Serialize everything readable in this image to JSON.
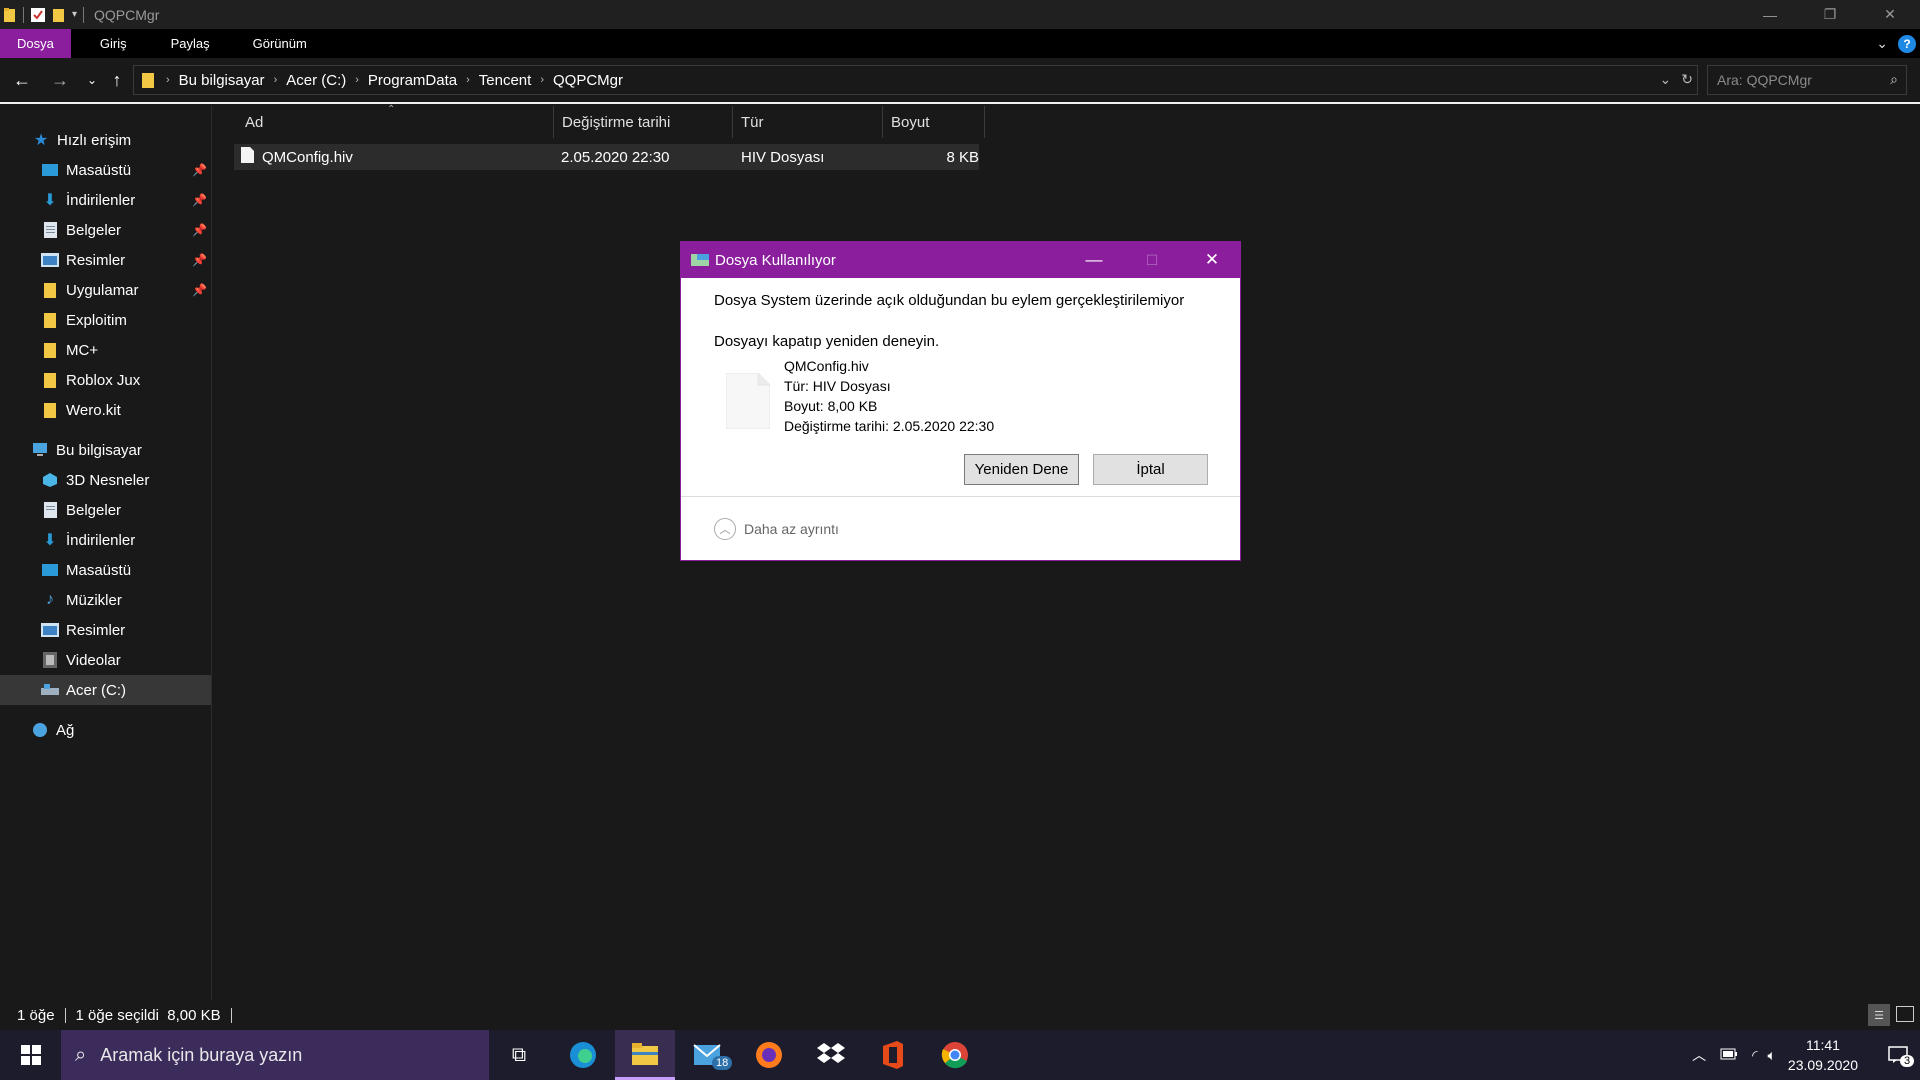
{
  "window": {
    "title": "QQPCMgr"
  },
  "ribbon": {
    "tabs": [
      "Dosya",
      "Giriş",
      "Paylaş",
      "Görünüm"
    ],
    "help": "?"
  },
  "address": {
    "crumbs": [
      "Bu bilgisayar",
      "Acer (C:)",
      "ProgramData",
      "Tencent",
      "QQPCMgr"
    ],
    "search_placeholder": "Ara: QQPCMgr"
  },
  "sidebar": {
    "quick_access": "Hızlı erişim",
    "quick_items": [
      {
        "label": "Masaüstü",
        "icon": "desktop-icon",
        "pinned": true
      },
      {
        "label": "İndirilenler",
        "icon": "downloads-icon",
        "pinned": true
      },
      {
        "label": "Belgeler",
        "icon": "documents-icon",
        "pinned": true
      },
      {
        "label": "Resimler",
        "icon": "pictures-icon",
        "pinned": true
      },
      {
        "label": "Uygulamar",
        "icon": "folder-icon",
        "pinned": true
      },
      {
        "label": "Exploitim",
        "icon": "folder-icon",
        "pinned": false
      },
      {
        "label": "MC+",
        "icon": "folder-icon",
        "pinned": false
      },
      {
        "label": "Roblox Jux",
        "icon": "folder-icon",
        "pinned": false
      },
      {
        "label": "Wero.kit",
        "icon": "folder-icon",
        "pinned": false
      }
    ],
    "this_pc": "Bu bilgisayar",
    "pc_items": [
      {
        "label": "3D Nesneler",
        "icon": "3d-objects-icon"
      },
      {
        "label": "Belgeler",
        "icon": "documents-icon"
      },
      {
        "label": "İndirilenler",
        "icon": "downloads-icon"
      },
      {
        "label": "Masaüstü",
        "icon": "desktop-icon"
      },
      {
        "label": "Müzikler",
        "icon": "music-icon"
      },
      {
        "label": "Resimler",
        "icon": "pictures-icon"
      },
      {
        "label": "Videolar",
        "icon": "videos-icon"
      },
      {
        "label": "Acer (C:)",
        "icon": "drive-icon",
        "selected": true
      }
    ],
    "network": "Ağ"
  },
  "files": {
    "columns": [
      "Ad",
      "Değiştirme tarihi",
      "Tür",
      "Boyut"
    ],
    "rows": [
      {
        "name": "QMConfig.hiv",
        "modified": "2.05.2020 22:30",
        "type": "HIV Dosyası",
        "size": "8 KB"
      }
    ]
  },
  "status": {
    "count": "1 öğe",
    "selection": "1 öğe seçildi  8,00 KB"
  },
  "dialog": {
    "title": "Dosya Kullanılıyor",
    "message": "Dosya System üzerinde açık olduğundan bu eylem gerçekleştirilemiyor",
    "hint": "Dosyayı kapatıp yeniden deneyin.",
    "file_name": "QMConfig.hiv",
    "file_type": "Tür: HIV Dosyası",
    "file_size": "Boyut: 8,00 KB",
    "file_modified": "Değiştirme tarihi: 2.05.2020 22:30",
    "retry": "Yeniden Dene",
    "cancel": "İptal",
    "less_details": "Daha az ayrıntı"
  },
  "taskbar": {
    "search_placeholder": "Aramak için buraya yazın",
    "mail_badge": "18",
    "time": "11:41",
    "date": "23.09.2020",
    "notifications": "3"
  },
  "colors": {
    "accent": "#8a1e9c",
    "background": "#191919"
  }
}
